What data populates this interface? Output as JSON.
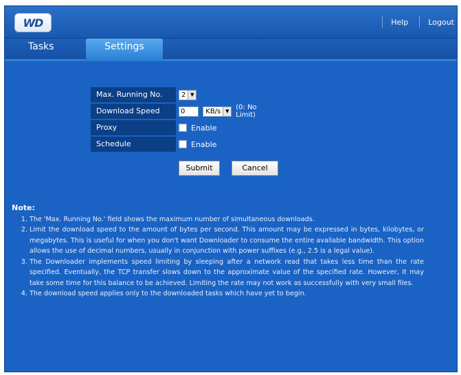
{
  "header": {
    "logo_text": "WD",
    "links": [
      "Help",
      "Logout"
    ]
  },
  "tabs": [
    {
      "label": "Tasks",
      "active": false
    },
    {
      "label": "Settings",
      "active": true
    }
  ],
  "form": {
    "max_running": {
      "label": "Max. Running No.",
      "value": "2"
    },
    "download_speed": {
      "label": "Download Speed",
      "value": "0",
      "unit": "KB/s",
      "hint": "(0: No Limit)"
    },
    "proxy": {
      "label": "Proxy",
      "checkbox_label": "Enable",
      "checked": false
    },
    "schedule": {
      "label": "Schedule",
      "checkbox_label": "Enable",
      "checked": false
    },
    "submit_label": "Submit",
    "cancel_label": "Cancel"
  },
  "note": {
    "title": "Note:",
    "items": [
      "The 'Max. Running No.' field shows the maximum number of simultaneous downloads.",
      "Limit the download speed to the amount of bytes per second. This amount may be expressed in bytes, kilobytes, or megabytes. This is useful for when you don't want Downloader to consume the entire available bandwidth. This option allows the use of decimal numbers, usually in conjunction with power suffixes (e.g., 2.5 is a legal value).",
      "The Downloader implements speed limiting by sleeping after a network read that takes less time than the rate specified. Eventually, the TCP transfer slows down to the approximate value of the specified rate. However, it may take some time for this balance to be achieved. Limiting the rate may not work as successfully with very small files.",
      "The download speed applies only to the downloaded tasks which have yet to begin."
    ]
  },
  "colors": {
    "background": "#1a63c4",
    "label_bg": "#0b3f86",
    "active_tab": "#4a9be6"
  }
}
